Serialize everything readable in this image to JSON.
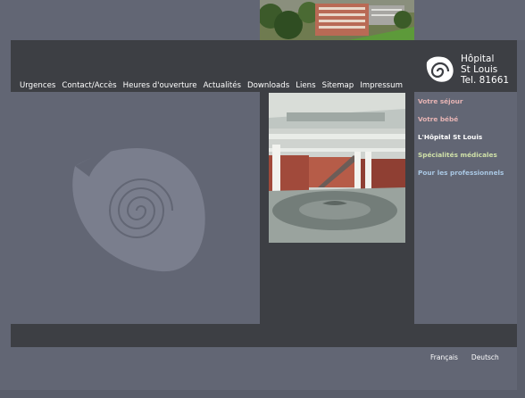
{
  "header": {
    "logo_line1": "Hôpital",
    "logo_line2": "St Louis",
    "logo_line3": "Tel. 81661"
  },
  "nav": [
    "Urgences",
    "Contact/Accès",
    "Heures d'ouverture",
    "Actualités",
    "Downloads",
    "Liens",
    "Sitemap",
    "Impressum"
  ],
  "sidebar": {
    "items": [
      {
        "label": "Votre séjour",
        "color": "#e7b4b4"
      },
      {
        "label": "Votre bébé",
        "color": "#e7b4b4"
      },
      {
        "label": "L'Hôpital St Louis",
        "color": "#ffffff"
      },
      {
        "label": "Spécialités médicales",
        "color": "#cfe0a8"
      },
      {
        "label": "Pour les professionnels",
        "color": "#aac8e4"
      }
    ]
  },
  "footer": {
    "languages": [
      "Français",
      "Deutsch"
    ]
  },
  "colors": {
    "background": "#626674",
    "dark_band": "#3d3f44",
    "swirl": "#7a7e8d"
  }
}
